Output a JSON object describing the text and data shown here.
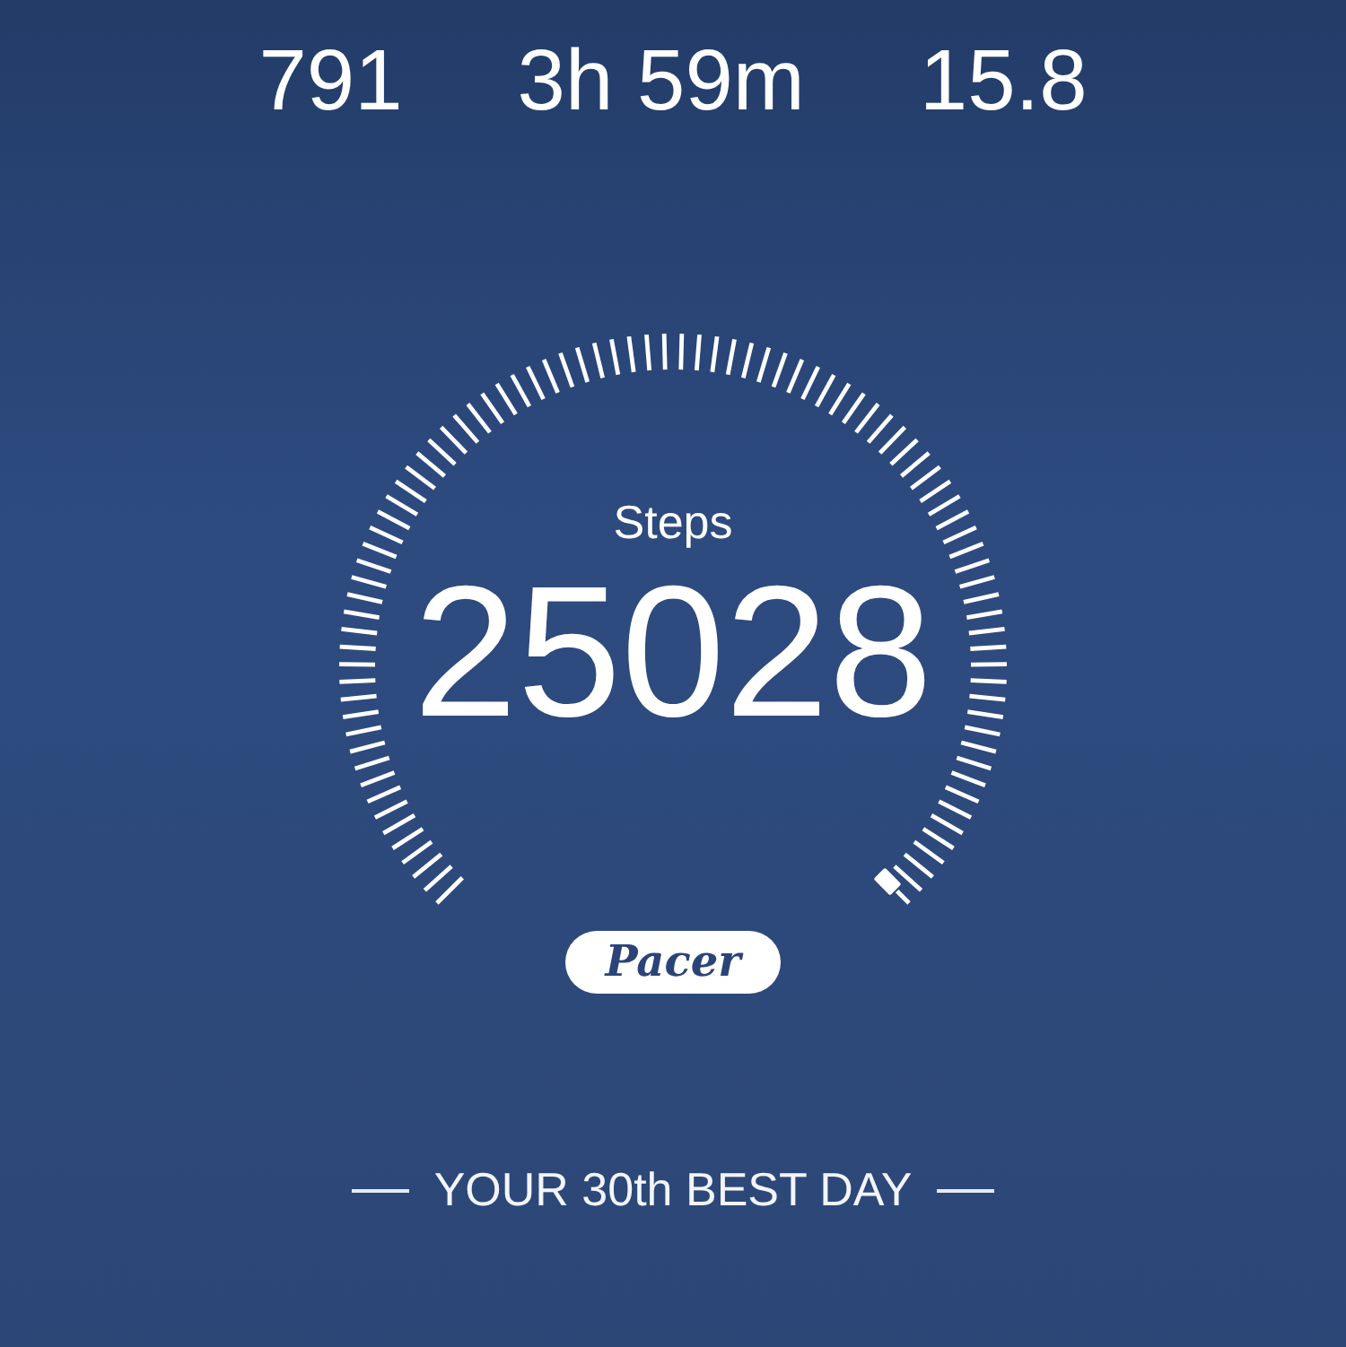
{
  "stats": [
    {
      "value": "791"
    },
    {
      "value": "3h 59m"
    },
    {
      "value": "15.8"
    }
  ],
  "gauge": {
    "label": "Steps",
    "value": "25028",
    "logo": "Pacer"
  },
  "rank": {
    "text": "YOUR 30th BEST DAY"
  }
}
